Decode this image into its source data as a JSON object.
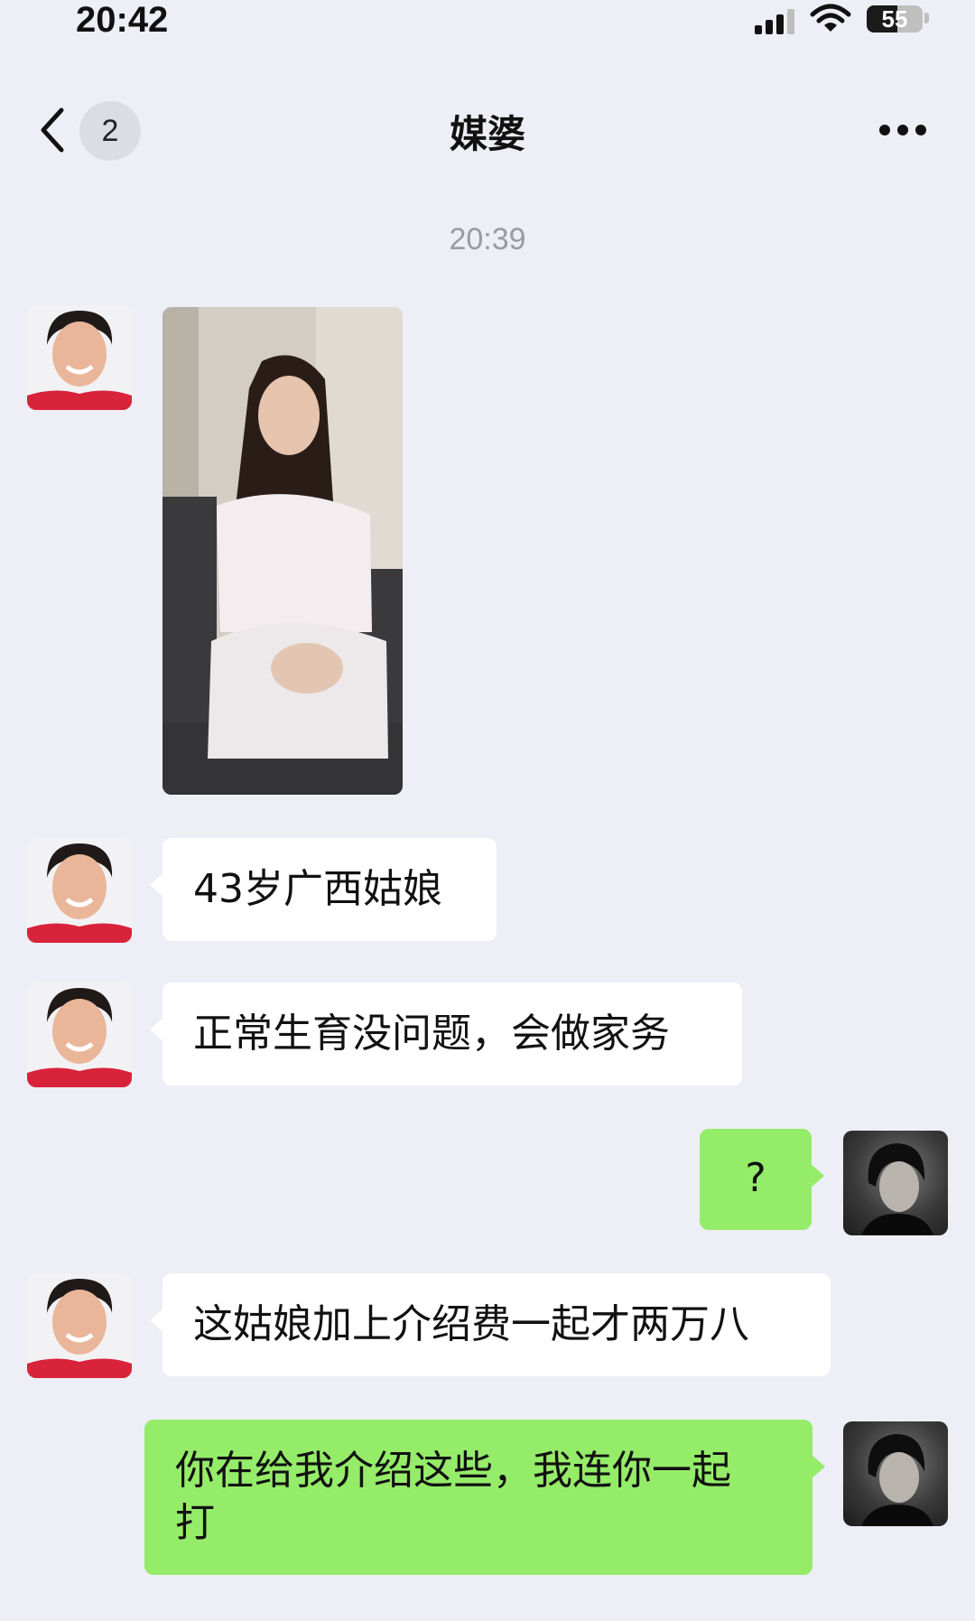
{
  "status_bar": {
    "time": "20:42",
    "battery": "55",
    "battery_level": 0.55,
    "icons": [
      "signal-icon",
      "wifi-icon",
      "battery-icon"
    ]
  },
  "nav": {
    "unread_count": "2",
    "title": "媒婆",
    "icons": [
      "chevron-left-icon",
      "more-icon"
    ]
  },
  "chat": {
    "timestamp": "20:39",
    "messages": [
      {
        "sender": "contact",
        "type": "image"
      },
      {
        "sender": "contact",
        "type": "text",
        "text": "43岁广西姑娘"
      },
      {
        "sender": "contact",
        "type": "text",
        "text": "正常生育没问题，会做家务"
      },
      {
        "sender": "me",
        "type": "text",
        "text": "?"
      },
      {
        "sender": "contact",
        "type": "text",
        "text": "这姑娘加上介绍费一起才两万八"
      },
      {
        "sender": "me",
        "type": "text",
        "lines": [
          "你在给我介绍这些，我连你一起",
          "打"
        ]
      }
    ]
  },
  "colors": {
    "background": "#eeeef7",
    "incoming_bubble": "#ffffff",
    "outgoing_bubble": "#95ec69",
    "timestamp": "#9a9aa3"
  }
}
